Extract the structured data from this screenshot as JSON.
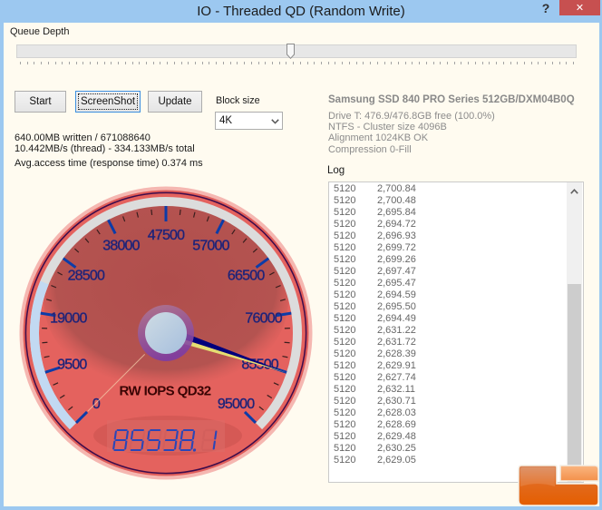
{
  "window": {
    "title": "IO - Threaded QD (Random Write)",
    "help_label": "?",
    "close_label": "✕"
  },
  "queue_depth": {
    "label": "Queue Depth",
    "slider_position": 0.49
  },
  "buttons": {
    "start": "Start",
    "screenshot": "ScreenShot",
    "update": "Update"
  },
  "block_size": {
    "label": "Block size",
    "value": "4K"
  },
  "stats": {
    "written": "640.00MB written / 671088640",
    "speed": "10.442MB/s (thread) - 334.133MB/s total",
    "access_time": "Avg.access time (response time) 0.374 ms"
  },
  "drive": {
    "model": "Samsung SSD 840 PRO Series 512GB/DXM04B0Q",
    "lines": [
      "Drive T: 476.9/476.8GB free (100.0%)",
      "NTFS - Cluster size 4096B",
      "Alignment 1024KB OK",
      "Compression 0-Fill"
    ]
  },
  "log": {
    "label": "Log",
    "rows": [
      {
        "block": "5120",
        "value": "2,700.84"
      },
      {
        "block": "5120",
        "value": "2,700.48"
      },
      {
        "block": "5120",
        "value": "2,695.84"
      },
      {
        "block": "5120",
        "value": "2,694.72"
      },
      {
        "block": "5120",
        "value": "2,696.93"
      },
      {
        "block": "5120",
        "value": "2,699.72"
      },
      {
        "block": "5120",
        "value": "2,699.26"
      },
      {
        "block": "5120",
        "value": "2,697.47"
      },
      {
        "block": "5120",
        "value": "2,695.47"
      },
      {
        "block": "5120",
        "value": "2,694.59"
      },
      {
        "block": "5120",
        "value": "2,695.50"
      },
      {
        "block": "5120",
        "value": "2,694.49"
      },
      {
        "block": "5120",
        "value": "2,631.22"
      },
      {
        "block": "5120",
        "value": "2,631.72"
      },
      {
        "block": "5120",
        "value": "2,628.39"
      },
      {
        "block": "5120",
        "value": "2,629.91"
      },
      {
        "block": "5120",
        "value": "2,627.74"
      },
      {
        "block": "5120",
        "value": "2,632.11"
      },
      {
        "block": "5120",
        "value": "2,630.71"
      },
      {
        "block": "5120",
        "value": "2,628.03"
      },
      {
        "block": "5120",
        "value": "2,628.69"
      },
      {
        "block": "5120",
        "value": "2,629.48"
      },
      {
        "block": "5120",
        "value": "2,630.25"
      },
      {
        "block": "5120",
        "value": "2,629.05"
      }
    ]
  },
  "gauge": {
    "title": "RW IOPS QD32",
    "value": 85538.1,
    "display": "85538.1",
    "min": 0,
    "max": 95000,
    "major_step": 9500,
    "minor_divisions": 4,
    "range_band": [
      0,
      23750
    ],
    "tick_labels": [
      "0",
      "9500",
      "19000",
      "28500",
      "38000",
      "47500",
      "57000",
      "66500",
      "76000",
      "85500",
      "95000"
    ]
  },
  "colors": {
    "title_bar": "#9cc8f0",
    "close_button": "#c75050",
    "window_background": "#fffbf0",
    "gauge_face": "#e4625e",
    "gauge_face_shade": "#b25150",
    "gauge_ring": "#dcdcdc",
    "gauge_band": "#c2d9f2",
    "major_tick": "#0c3ca8",
    "minor_tick": "#3a1e1e",
    "tick_label": "#1f1f6c",
    "needle": "#00007c",
    "needle_highlight": "#e4de72",
    "digits": "#2a46b8",
    "gauge_title": "#3a0404"
  }
}
